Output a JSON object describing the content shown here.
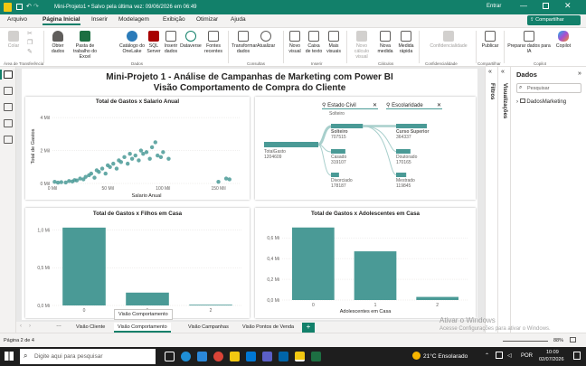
{
  "window": {
    "title": "Mini-Projeto1 • Salvo pela última vez: 09/06/2026 em 06:49",
    "user_label": "Entrar",
    "share_label": "Compartilhar"
  },
  "ribbon_tabs": [
    "Arquivo",
    "Página Inicial",
    "Inserir",
    "Modelagem",
    "Exibição",
    "Otimizar",
    "Ajuda"
  ],
  "ribbon": {
    "paste": "Colar",
    "clipboard_group": "Área de Transferência",
    "get_data": "Obter dados",
    "excel": "Pasta de trabalho do Excel",
    "onelake": "Catálogo do OneLake",
    "sql": "SQL Server",
    "enter_data": "Inserir dados",
    "dataverse": "Dataverse",
    "recent": "Fontes recentes",
    "data_group": "Dados",
    "transform": "Transformar dados",
    "refresh": "Atualizar",
    "queries_group": "Consultas",
    "new_visual": "Novo visual",
    "text_box": "Caixa de texto",
    "more_visuals": "Mais visuais",
    "insert_group": "Inserir",
    "new_visual_calc": "Novo cálculo visual",
    "new_measure": "Nova medida",
    "quick_measure": "Medida rápida",
    "calc_group": "Cálculos",
    "sensitivity": "Confidencialidade",
    "sensitivity_group": "Confidencialidade",
    "publish": "Publicar",
    "share_group": "Compartilhar",
    "copilot_prep": "Preparar dados para IA",
    "copilot": "Copilot",
    "copilot_group": "Copilot"
  },
  "report": {
    "title_line1": "Mini-Projeto 1 - Análise de Campanhas de Marketing com Power BI",
    "title_line2": "Visão Comportamento de Compra do Cliente"
  },
  "scatter": {
    "title": "Total de Gastos x Salario Anual",
    "ylabel": "Total de Gastos",
    "xlabel": "Salario Anual",
    "yticks": [
      "0 Mil",
      "2 Mil",
      "4 Mil"
    ],
    "xticks": [
      "0 Mil",
      "50 Mil",
      "100 Mil",
      "150 Mil"
    ]
  },
  "decomp": {
    "filter1": "Estado Civil",
    "filter2": "Escolaridade",
    "col1_header": "Solteiro",
    "root_label": "TotalGasto",
    "root_value": "1204609",
    "level1": [
      {
        "label": "Solteiro",
        "value": "707515"
      },
      {
        "label": "Casado",
        "value": "319107"
      },
      {
        "label": "Divorciado",
        "value": "178187"
      }
    ],
    "level2": [
      {
        "label": "Curso Superior",
        "value": "364337"
      },
      {
        "label": "Doutorado",
        "value": "170165"
      },
      {
        "label": "Mestrado",
        "value": "119845"
      }
    ]
  },
  "chart_data": [
    {
      "type": "scatter",
      "title": "Total de Gastos x Salario Anual",
      "xlabel": "Salario Anual",
      "ylabel": "Total de Gastos",
      "xlim": [
        0,
        170000
      ],
      "ylim": [
        0,
        4500
      ],
      "x": [
        2000,
        5000,
        8000,
        12000,
        15000,
        18000,
        20000,
        22000,
        25000,
        28000,
        30000,
        33000,
        35000,
        38000,
        40000,
        42000,
        45000,
        48000,
        50000,
        52000,
        55000,
        58000,
        60000,
        62000,
        65000,
        68000,
        70000,
        72000,
        75000,
        78000,
        80000,
        82000,
        85000,
        88000,
        90000,
        93000,
        95000,
        98000,
        100000,
        105000,
        150000,
        157000,
        160000
      ],
      "y": [
        100,
        50,
        80,
        60,
        150,
        120,
        200,
        180,
        300,
        250,
        400,
        500,
        600,
        350,
        800,
        700,
        900,
        600,
        1100,
        1000,
        1200,
        900,
        1400,
        1300,
        1600,
        1200,
        1800,
        1500,
        1700,
        1400,
        2000,
        1800,
        1900,
        1500,
        2200,
        2500,
        1700,
        1600,
        1900,
        1500,
        100,
        300,
        250
      ],
      "grid": true
    },
    {
      "type": "bar",
      "title": "Total de Gastos x Filhos em Casa",
      "categories": [
        "0",
        "1",
        "2"
      ],
      "values": [
        1.03,
        0.17,
        0.01
      ],
      "ylabel": "",
      "ylim": [
        0,
        1.1
      ],
      "yticks": [
        "0,0 Mi",
        "0,5 Mi",
        "1,0 Mi"
      ]
    },
    {
      "type": "bar",
      "title": "Total de Gastos x Adolescentes em Casa",
      "categories": [
        "0",
        "1",
        "2"
      ],
      "values": [
        0.7,
        0.47,
        0.03
      ],
      "xlabel": "Adolescentes em Casa",
      "ylim": [
        0,
        0.75
      ],
      "yticks": [
        "0,0 Mi",
        "0,2 Mi",
        "0,4 Mi",
        "0,6 Mi"
      ]
    }
  ],
  "bar1": {
    "title": "Total de Gastos x Filhos em Casa"
  },
  "bar2": {
    "title": "Total de Gastos x Adolescentes em Casa",
    "xlabel": "Adolescentes em Casa"
  },
  "panes": {
    "filters": "Filtros",
    "visualizations": "Visualizações",
    "data_title": "Dados",
    "search_placeholder": "Pesquisar",
    "table": "DadosMarketing"
  },
  "page_tabs": [
    "Visão Cliente",
    "Visão Comportamento",
    "Visão Campanhas",
    "Visão Pontos de Venda"
  ],
  "tooltip": "Visão Comportamento",
  "status": {
    "page": "Página 2 de 4",
    "zoom": "88%",
    "activate1": "Ativar o Windows",
    "activate2": "Acesse Configurações para ativar o Windows."
  },
  "taskbar": {
    "search_placeholder": "Digite aqui para pesquisar",
    "weather": "21°C Ensolarado",
    "lang": "POR",
    "time": "10:09",
    "date": "02/07/2026"
  },
  "colors": {
    "brand": "#12806a",
    "bar": "#4a9a96",
    "dark": "#252423"
  }
}
